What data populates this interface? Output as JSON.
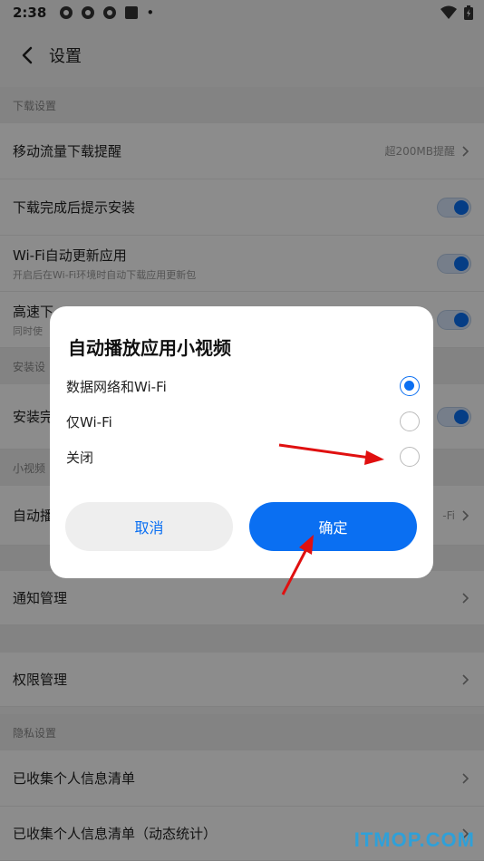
{
  "status_bar": {
    "time": "2:38",
    "dot": "•"
  },
  "header": {
    "title": "设置"
  },
  "sections": {
    "download": "下载设置",
    "install": "安装设",
    "small_video": "小视频",
    "privacy": "隐私设置"
  },
  "rows": {
    "mobile_data": {
      "label": "移动流量下载提醒",
      "value": "超200MB提醒"
    },
    "prompt_install": {
      "label": "下载完成后提示安装"
    },
    "wifi_update": {
      "label": "Wi-Fi自动更新应用",
      "sub": "开启后在Wi-Fi环境时自动下载应用更新包"
    },
    "high_speed": {
      "label": "高速下",
      "sub": "同时使"
    },
    "install_done": {
      "label": "安装完"
    },
    "auto_play": {
      "label": "自动播",
      "value": "-Fi"
    },
    "notification": {
      "label": "通知管理"
    },
    "permission": {
      "label": "权限管理"
    },
    "personal_info": {
      "label": "已收集个人信息清单"
    },
    "personal_info_dynamic": {
      "label": "已收集个人信息清单（动态统计）"
    }
  },
  "dialog": {
    "title": "自动播放应用小视频",
    "options": [
      {
        "label": "数据网络和Wi-Fi",
        "selected": true
      },
      {
        "label": "仅Wi-Fi",
        "selected": false
      },
      {
        "label": "关闭",
        "selected": false
      }
    ],
    "cancel_label": "取消",
    "confirm_label": "确定"
  },
  "watermark": "ITMOP.COM",
  "colors": {
    "accent": "#0a6ff2",
    "annotation_arrow": "#e01010"
  }
}
